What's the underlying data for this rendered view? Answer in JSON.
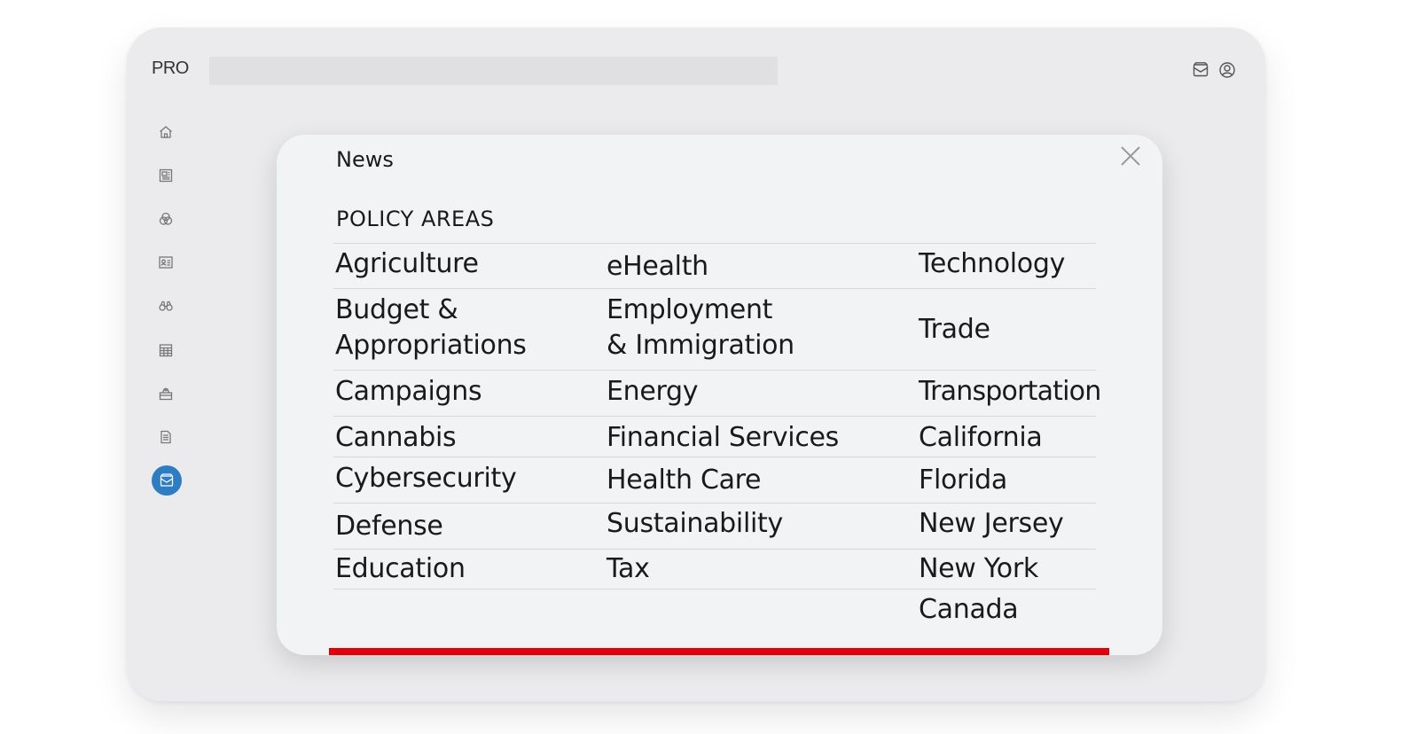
{
  "app": {
    "logo": "PRO"
  },
  "modal": {
    "title": "News",
    "section_title": "POLICY AREAS",
    "col1": [
      "Agriculture",
      "Budget &",
      "Appropriations",
      "Campaigns",
      "Cannabis",
      "Cybersecurity",
      "Defense",
      "Education"
    ],
    "col2": [
      "eHealth",
      "Employment",
      "& Immigration",
      "Energy",
      "Financial Services",
      "Health Care",
      "Sustainability",
      "Tax"
    ],
    "col3": [
      "Technology",
      "Trade",
      "Transportation",
      "California",
      "Florida",
      "New Jersey",
      "New York",
      "Canada"
    ]
  },
  "colors": {
    "accent_red": "#e0000a",
    "active_nav": "#2e7dc4"
  },
  "icons": [
    "home-icon",
    "newspaper-icon",
    "venn-icon",
    "contact-card-icon",
    "binoculars-icon",
    "calendar-icon",
    "briefcase-icon",
    "document-icon",
    "inbox-icon",
    "close-icon",
    "user-icon"
  ]
}
